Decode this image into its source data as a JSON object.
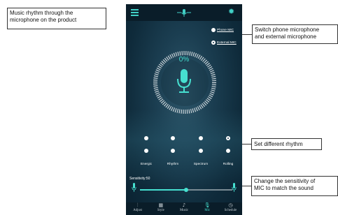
{
  "callouts": {
    "rhythm_intro": [
      "Music rhythm through the",
      "microphone on the product"
    ],
    "switch_mic": [
      "Switch phone microphone",
      "and external microphone"
    ],
    "rhythm_modes": [
      "Set different rhythm"
    ],
    "sensitivity": [
      "Change the sensitivity of",
      "MIC to match the sound"
    ]
  },
  "app": {
    "mic_options": [
      {
        "label": "Phone MIC",
        "selected": false
      },
      {
        "label": "External MIC",
        "selected": true
      }
    ],
    "level_percent": "0%",
    "modes": [
      {
        "label": "Energic",
        "selected": false
      },
      {
        "label": "Rhythm",
        "selected": false
      },
      {
        "label": "Spectrum",
        "selected": false
      },
      {
        "label": "Rolling",
        "selected": true
      }
    ],
    "sensitivity_label": "Sensitivity:50",
    "sensitivity_value": 50,
    "tabs": [
      {
        "label": "Adjust",
        "icon": "sliders-icon",
        "active": false
      },
      {
        "label": "Style",
        "icon": "grid-icon",
        "active": false
      },
      {
        "label": "Music",
        "icon": "music-icon",
        "active": false
      },
      {
        "label": "Mic",
        "icon": "mic-icon",
        "active": true
      },
      {
        "label": "Schedule",
        "icon": "clock-icon",
        "active": false
      }
    ]
  },
  "colors": {
    "accent": "#46e0d0",
    "background": "#1b3e51",
    "bar": "#0a1d29"
  }
}
